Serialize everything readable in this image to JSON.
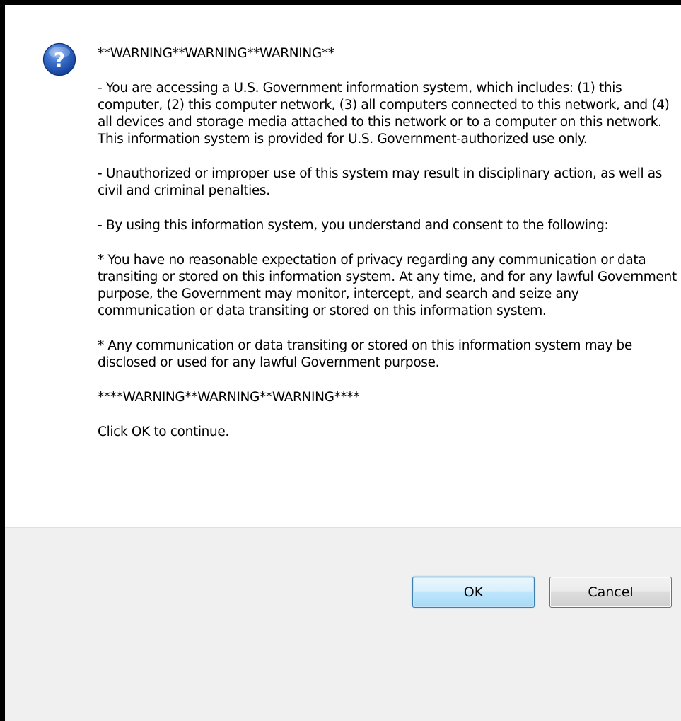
{
  "dialog": {
    "icon": "question-icon",
    "message": "**WARNING**WARNING**WARNING**\n\n- You are accessing a U.S. Government information system, which includes: (1) this computer, (2) this computer network, (3) all computers connected to this network, and (4) all devices and storage media attached to this network or to a computer on this network. This information system is provided for U.S. Government-authorized use only.\n\n- Unauthorized or improper use of this system may result in disciplinary action, as well as civil and criminal penalties.\n\n- By using this information system, you understand and consent to the following:\n\n* You have no reasonable expectation of privacy regarding any communication or data transiting or stored on this information system. At any time, and for any lawful Government purpose, the Government may monitor, intercept, and search and seize any communication or data transiting or stored on this information system.\n\n* Any communication or data transiting or stored on this information system may be disclosed or used for any lawful Government purpose.\n\n****WARNING**WARNING**WARNING****\n\nClick OK to continue.",
    "buttons": {
      "ok_label": "OK",
      "cancel_label": "Cancel"
    }
  },
  "colors": {
    "icon_blue": "#2b5fb8",
    "footer_bg": "#f0f0f0",
    "default_button_border": "#3c7fb1"
  }
}
